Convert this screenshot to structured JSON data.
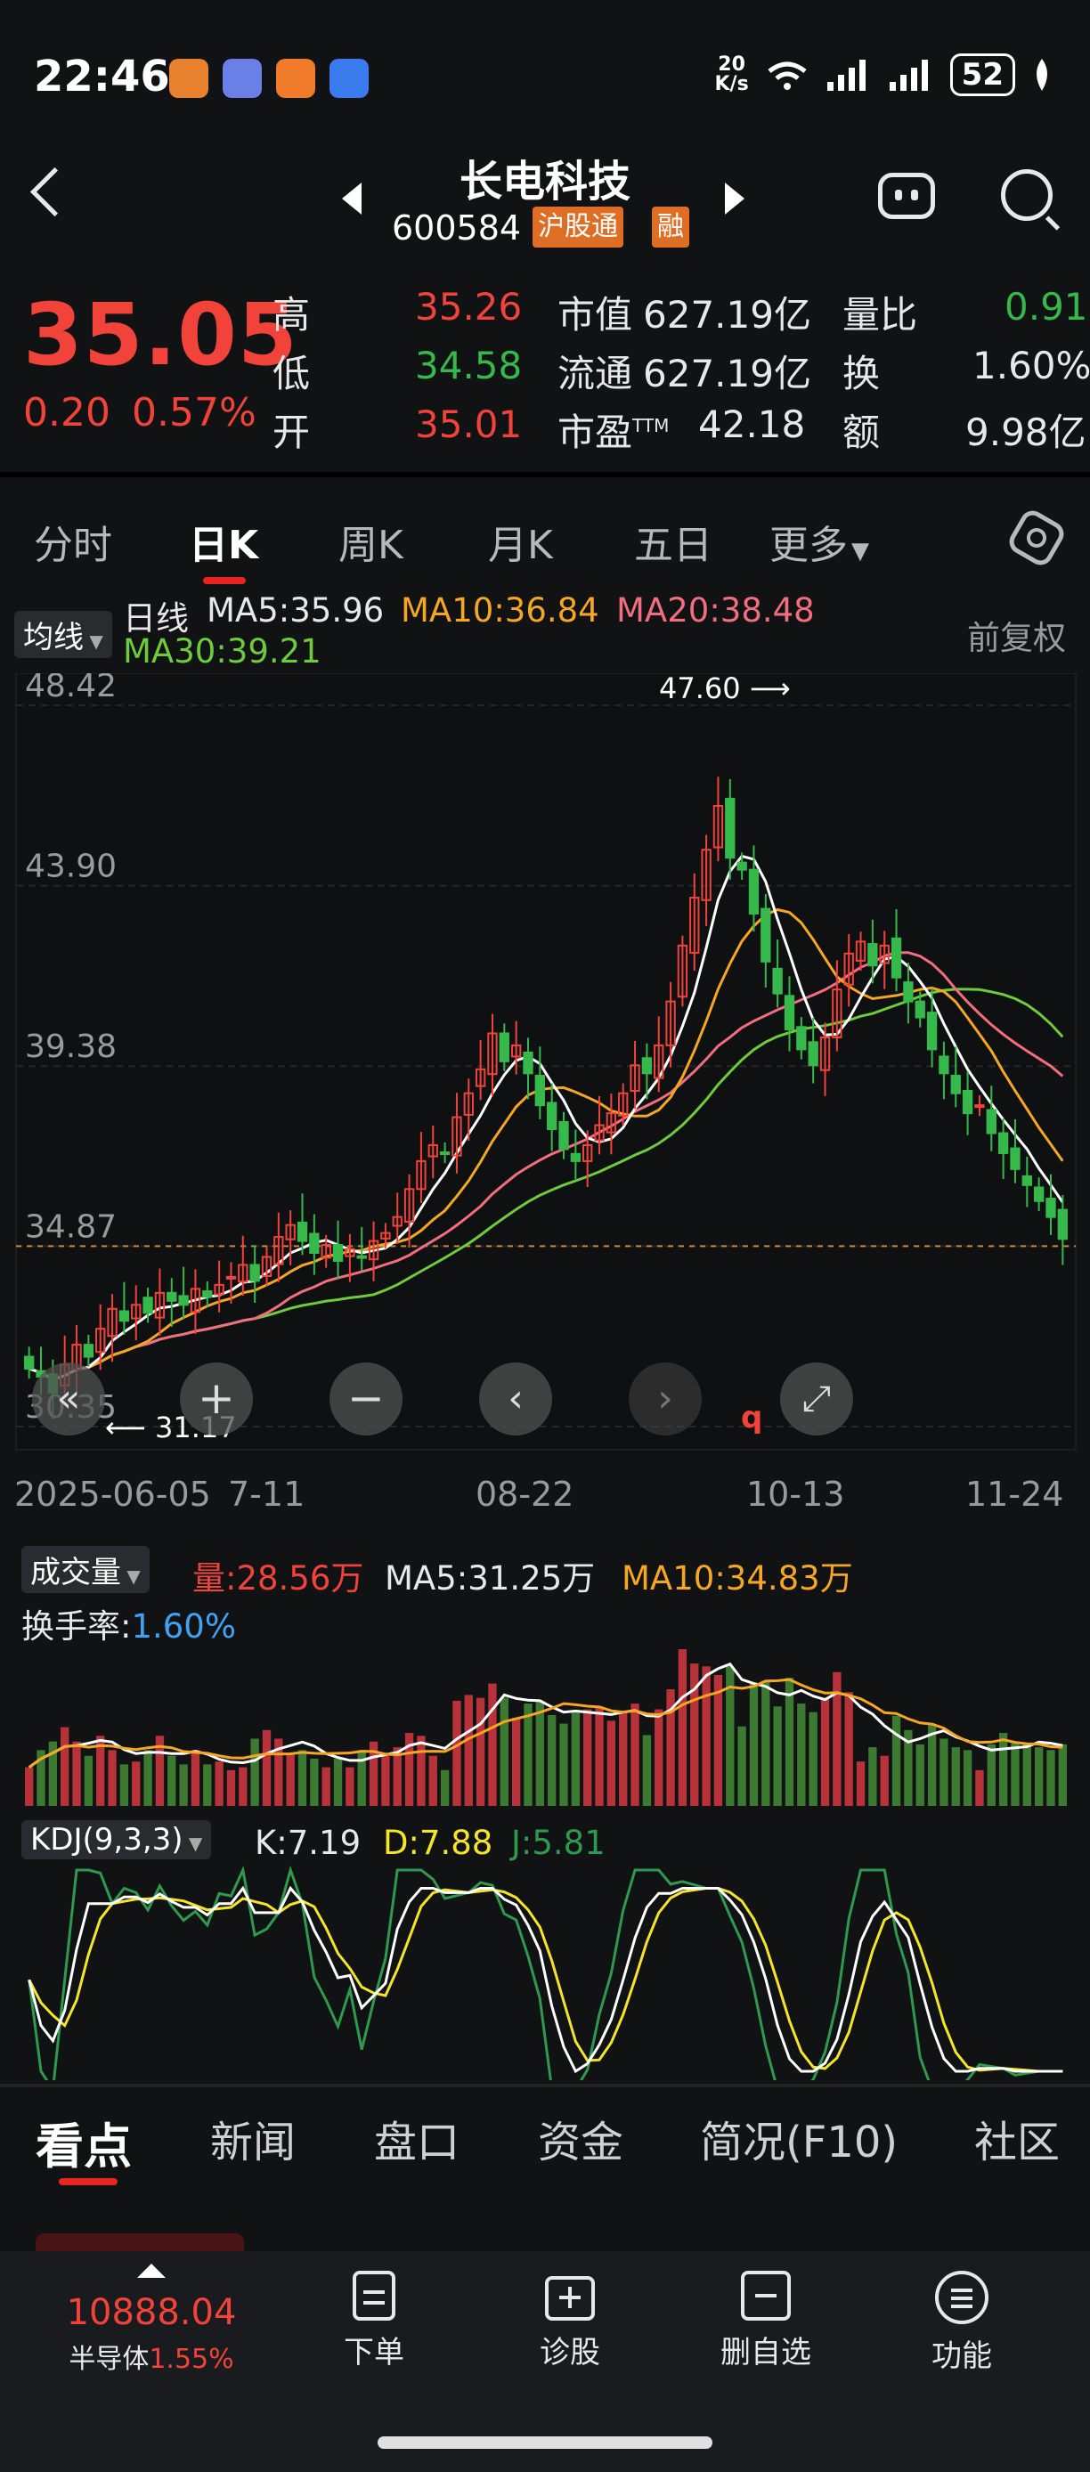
{
  "status_bar": {
    "time": "22:46",
    "net_speed_top": "20",
    "net_speed_bottom": "K/s",
    "battery": "52",
    "app_icons": [
      "calculator-app-icon",
      "message-app-icon",
      "toutiao-app-icon",
      "security-app-icon"
    ],
    "colors": [
      "#e8822e",
      "#6a7fe8",
      "#f07b2a",
      "#3a7cf0"
    ]
  },
  "header": {
    "stock_name": "长电科技",
    "stock_code": "600584",
    "badge_connect": "沪股通",
    "badge_margin": "融"
  },
  "quote": {
    "price": "35.05",
    "change": "0.20",
    "change_pct": "0.57%",
    "high_label": "高",
    "high": "35.26",
    "low_label": "低",
    "low": "34.58",
    "open_label": "开",
    "open": "35.01",
    "mktcap_label": "市值",
    "mktcap": "627.19亿",
    "float_label": "流通",
    "float": "627.19亿",
    "pe_label": "市盈",
    "pe_sup": "TTM",
    "pe": "42.18",
    "vol_ratio_label": "量比",
    "vol_ratio": "0.91",
    "turnover_label": "换",
    "turnover": "1.60%",
    "amount_label": "额",
    "amount": "9.98亿"
  },
  "tabs": [
    "分时",
    "日K",
    "周K",
    "月K",
    "五日",
    "更多"
  ],
  "active_tab": "日K",
  "ma_legend": {
    "selector": "均线",
    "period": "日线",
    "ma5": "MA5:35.96",
    "ma10": "MA10:36.84",
    "ma20": "MA20:38.48",
    "ma30": "MA30:39.21",
    "adjust": "前复权"
  },
  "chart_data": [
    {
      "type": "candlestick",
      "y_ticks": [
        "48.42",
        "43.90",
        "39.38",
        "34.87",
        "30.35"
      ],
      "ylim": [
        30.35,
        48.42
      ],
      "x_ticks": [
        "2025-06-05",
        "7-11",
        "08-22",
        "10-13",
        "11-24"
      ],
      "max_label": "47.60",
      "min_label": "31.17",
      "current_price_line": 34.87,
      "colors": {
        "up": "#f2433a",
        "down": "#35b94a",
        "ma5": "#ffffff",
        "ma10": "#f5a623",
        "ma20": "#f26d7d",
        "ma30": "#6ecb3c"
      },
      "close": [
        31.8,
        31.6,
        31.2,
        31.9,
        32.4,
        32.1,
        32.8,
        33.3,
        33.0,
        33.4,
        33.2,
        33.7,
        33.5,
        33.4,
        33.8,
        33.6,
        33.9,
        34.1,
        34.4,
        34.0,
        34.6,
        35.1,
        35.4,
        35.0,
        34.7,
        34.9,
        34.5,
        34.8,
        34.6,
        35.0,
        35.2,
        35.6,
        36.3,
        37.0,
        37.4,
        37.2,
        38.1,
        38.7,
        39.3,
        40.2,
        39.5,
        39.9,
        39.2,
        38.4,
        37.8,
        37.3,
        37.0,
        37.4,
        37.9,
        38.2,
        38.7,
        39.4,
        39.2,
        39.9,
        41.0,
        42.4,
        43.6,
        44.8,
        45.9,
        44.6,
        44.3,
        43.2,
        42.0,
        41.2,
        40.3,
        39.8,
        39.4,
        40.1,
        41.3,
        42.2,
        42.5,
        41.9,
        42.4,
        41.6,
        41.0,
        40.6,
        39.8,
        39.2,
        38.7,
        38.2,
        38.4,
        37.7,
        37.2,
        36.8,
        36.4,
        36.0,
        35.6,
        35.05
      ],
      "volume_label": "量:28.56万",
      "volume_ma5": "MA5:31.25万",
      "volume_ma10": "MA10:34.83万",
      "volume_selector": "成交量",
      "turnover_label": "换手率:",
      "turnover_value": "1.60%"
    },
    {
      "type": "line",
      "selector": "KDJ(9,3,3)",
      "k": "K:7.19",
      "d": "D:7.88",
      "j": "J:5.81",
      "colors": {
        "k": "#ffffff",
        "d": "#f5e52a",
        "j": "#2e9a4e"
      }
    }
  ],
  "chart_controls": [
    "collapse-icon",
    "zoom-in-icon",
    "zoom-out-icon",
    "pan-left-icon",
    "pan-right-icon",
    "fullscreen-icon"
  ],
  "news_tabs": [
    "看点",
    "新闻",
    "盘口",
    "资金",
    "简况(F10)",
    "社区"
  ],
  "bottom_nav": {
    "index_value": "10888.04",
    "index_name": "半导体",
    "index_pct": "1.55%",
    "items": [
      "下单",
      "诊股",
      "删自选",
      "功能"
    ]
  }
}
